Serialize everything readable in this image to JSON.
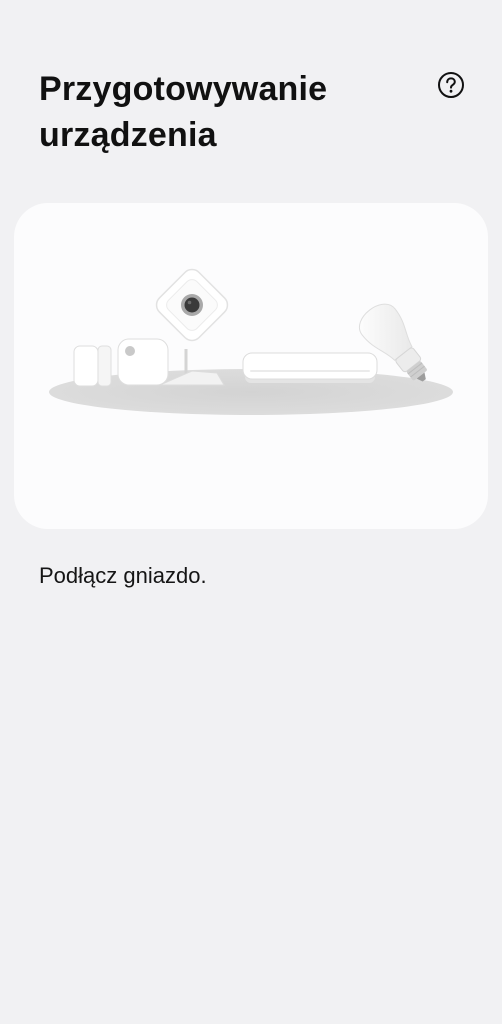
{
  "header": {
    "title": "Przygotowywanie urządzenia",
    "help_icon": "question-circle-icon"
  },
  "illustration": {
    "devices": [
      "door-sensor-icon",
      "motion-sensor-icon",
      "camera-icon",
      "hub-icon",
      "bulb-icon"
    ]
  },
  "main": {
    "instruction": "Podłącz gniazdo."
  },
  "colors": {
    "background": "#f1f1f3",
    "card": "#fcfcfd",
    "text": "#111111",
    "floor": "#d9d9d9"
  }
}
